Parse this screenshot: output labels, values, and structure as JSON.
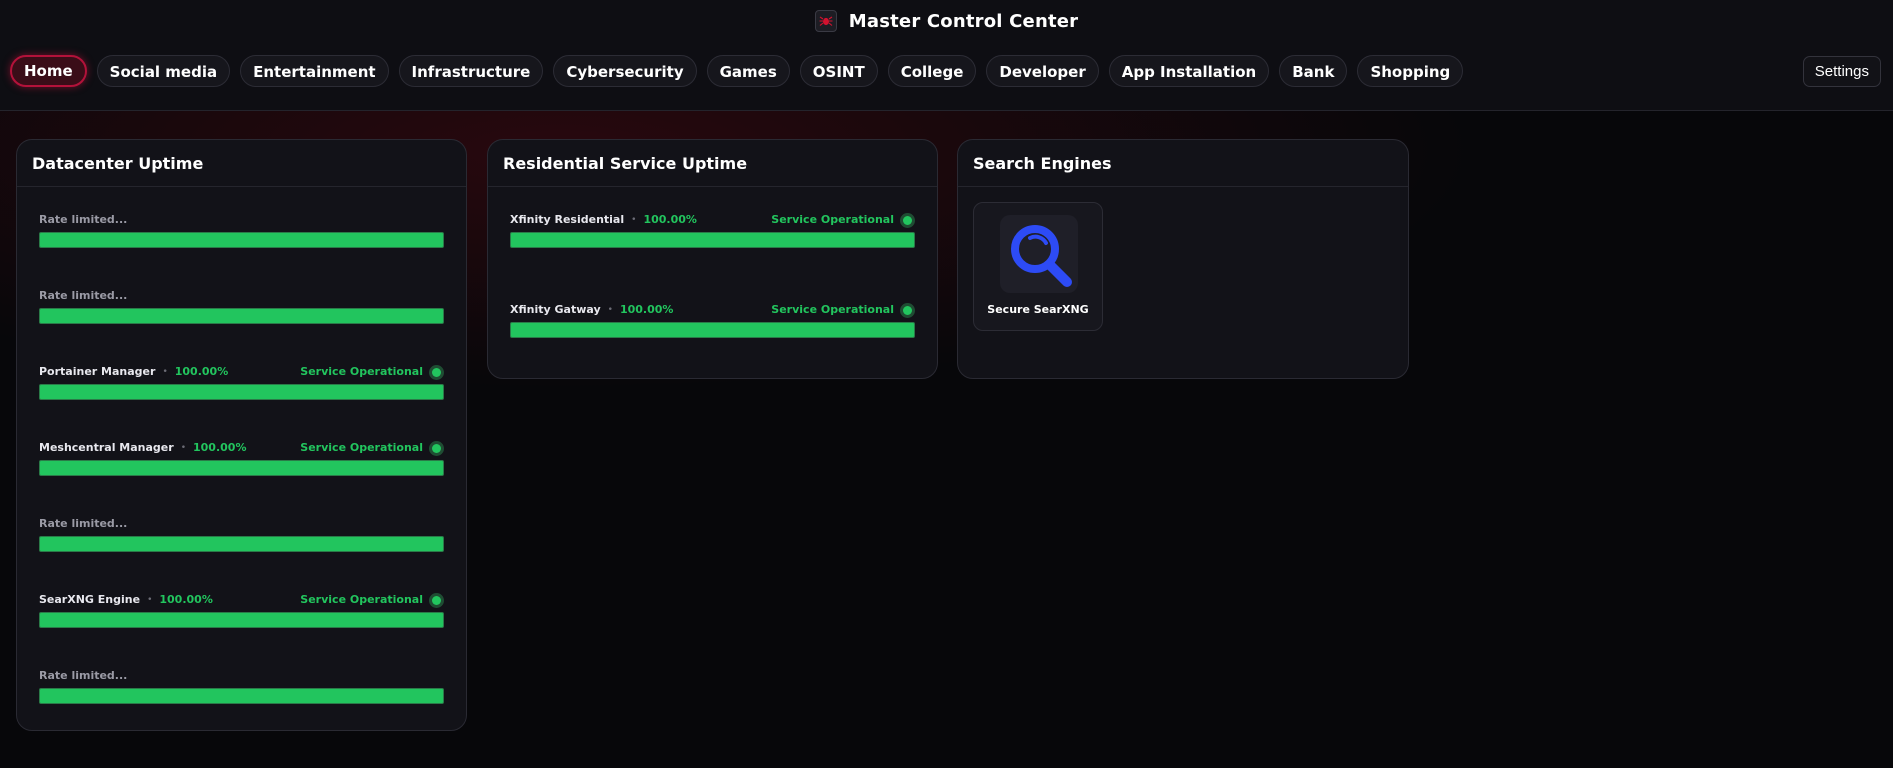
{
  "header": {
    "title": "Master Control Center",
    "logo_icon": "spider-logo-icon"
  },
  "nav": {
    "tabs": [
      {
        "label": "Home",
        "active": true
      },
      {
        "label": "Social media"
      },
      {
        "label": "Entertainment"
      },
      {
        "label": "Infrastructure"
      },
      {
        "label": "Cybersecurity"
      },
      {
        "label": "Games"
      },
      {
        "label": "OSINT"
      },
      {
        "label": "College"
      },
      {
        "label": "Developer"
      },
      {
        "label": "App Installation"
      },
      {
        "label": "Bank"
      },
      {
        "label": "Shopping"
      }
    ],
    "settings_label": "Settings"
  },
  "colors": {
    "accent": "#b3123a",
    "ok_green": "#22c55e",
    "search_icon_blue": "#2d4bf5"
  },
  "cards": {
    "datacenter": {
      "title": "Datacenter Uptime",
      "monitors": [
        {
          "limited_text": "Rate limited...",
          "uptime_fraction": 1.0
        },
        {
          "limited_text": "Rate limited...",
          "uptime_fraction": 1.0
        },
        {
          "name": "Portainer Manager",
          "sep": "•",
          "pct": "100.00%",
          "status": "Service Operational",
          "uptime_fraction": 1.0
        },
        {
          "name": "Meshcentral Manager",
          "sep": "•",
          "pct": "100.00%",
          "status": "Service Operational",
          "uptime_fraction": 1.0
        },
        {
          "limited_text": "Rate limited...",
          "uptime_fraction": 1.0
        },
        {
          "name": "SearXNG Engine",
          "sep": "•",
          "pct": "100.00%",
          "status": "Service Operational",
          "uptime_fraction": 1.0
        },
        {
          "limited_text": "Rate limited...",
          "uptime_fraction": 1.0
        }
      ]
    },
    "residential": {
      "title": "Residential Service Uptime",
      "monitors": [
        {
          "name": "Xfinity Residential",
          "sep": "•",
          "pct": "100.00%",
          "status": "Service Operational",
          "uptime_fraction": 1.0
        },
        {
          "name": "Xfinity Gatway",
          "sep": "•",
          "pct": "100.00%",
          "status": "Service Operational",
          "uptime_fraction": 1.0
        }
      ]
    },
    "search": {
      "title": "Search Engines",
      "tiles": [
        {
          "label": "Secure SearXNG",
          "icon": "magnifier-icon"
        }
      ]
    }
  }
}
